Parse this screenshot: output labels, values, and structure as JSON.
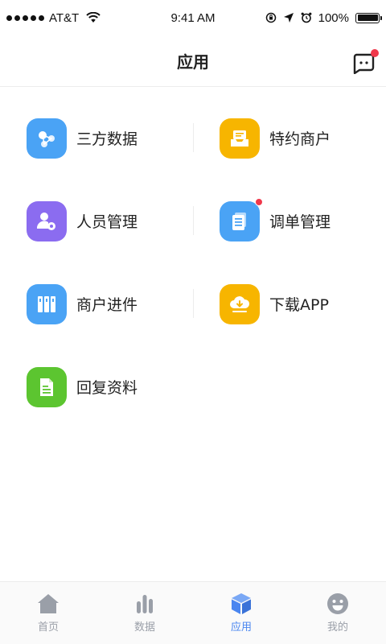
{
  "status_bar": {
    "carrier": "AT&T",
    "time": "9:41 AM",
    "battery": "100%"
  },
  "header": {
    "title": "应用",
    "message_has_badge": true
  },
  "apps": [
    {
      "label": "三方数据",
      "icon": "share-data-icon",
      "color": "#4aa3f5",
      "badge": false
    },
    {
      "label": "特约商户",
      "icon": "inbox-merchant-icon",
      "color": "#f7b500",
      "badge": false
    },
    {
      "label": "人员管理",
      "icon": "user-settings-icon",
      "color": "#8b6cf0",
      "badge": false
    },
    {
      "label": "调单管理",
      "icon": "document-icon",
      "color": "#4aa3f5",
      "badge": true
    },
    {
      "label": "商户进件",
      "icon": "binders-icon",
      "color": "#4aa3f5",
      "badge": false
    },
    {
      "label": "下载APP",
      "icon": "cloud-download-icon",
      "color": "#f7b500",
      "badge": false
    },
    {
      "label": "回复资料",
      "icon": "file-icon",
      "color": "#5cc530",
      "badge": false
    }
  ],
  "tabs": [
    {
      "label": "首页",
      "icon": "home-icon",
      "active": false
    },
    {
      "label": "数据",
      "icon": "bar-chart-icon",
      "active": false
    },
    {
      "label": "应用",
      "icon": "cube-icon",
      "active": true
    },
    {
      "label": "我的",
      "icon": "smiley-icon",
      "active": false
    }
  ],
  "colors": {
    "accent": "#4a86f0",
    "inactive_tab": "#9a9fa8",
    "badge": "#f0384b"
  }
}
